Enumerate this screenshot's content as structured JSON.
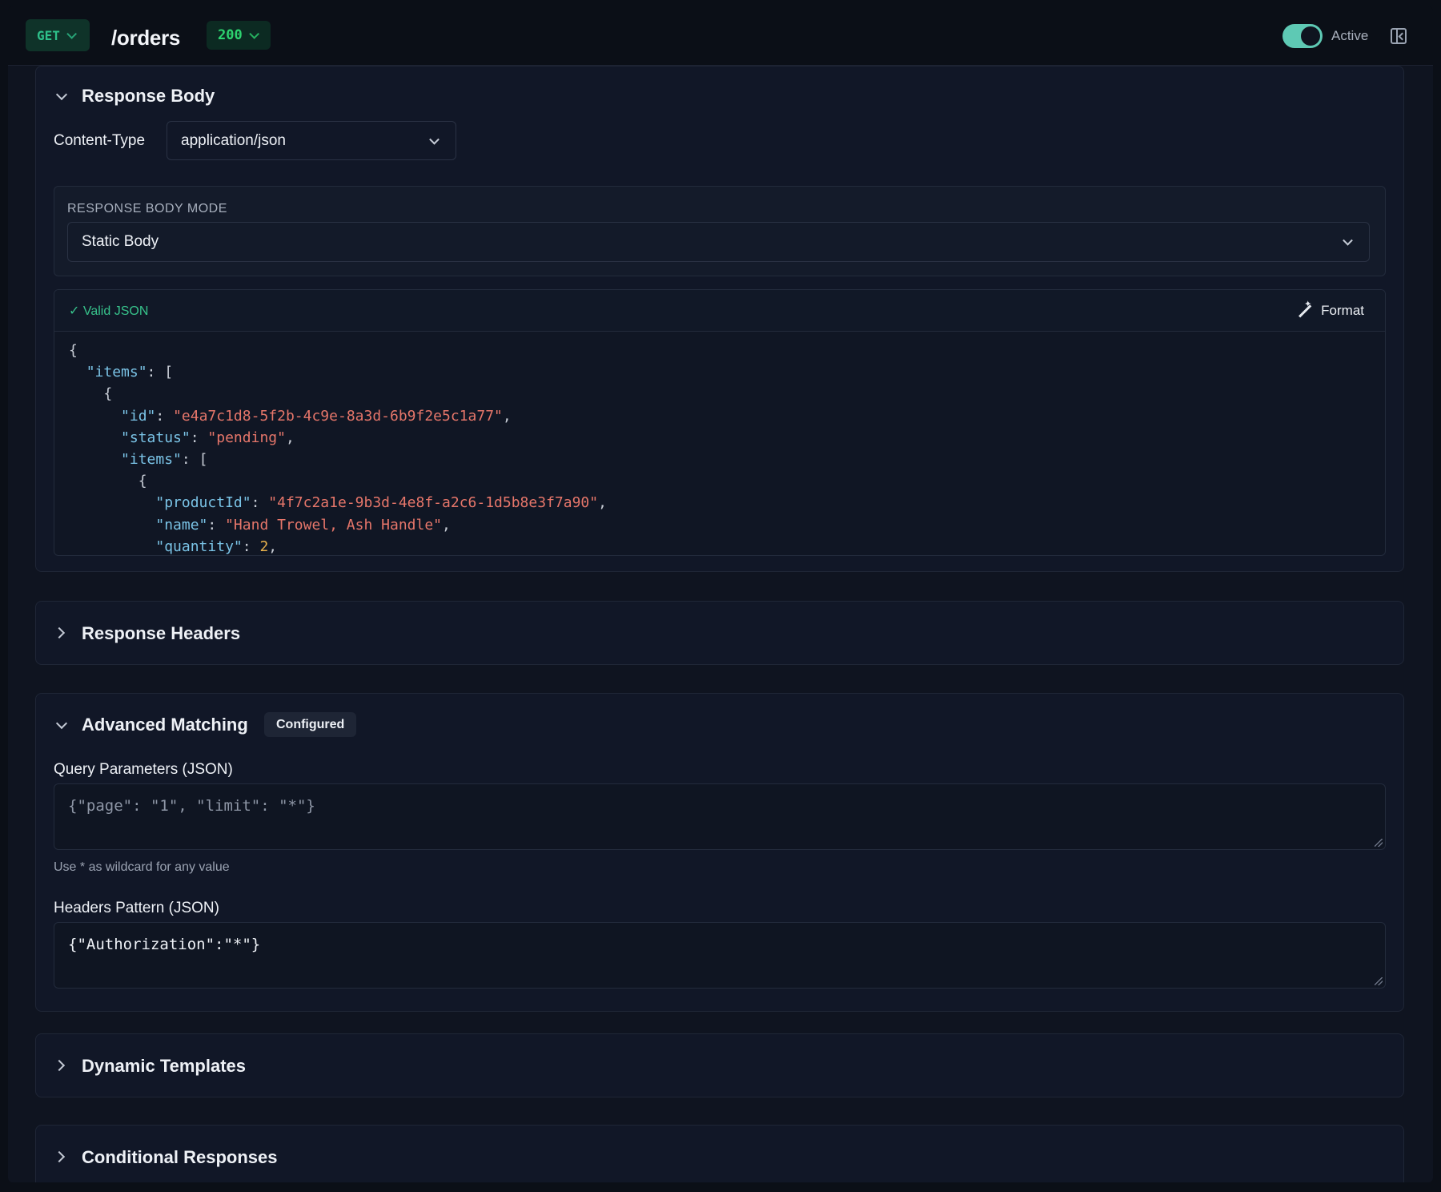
{
  "header": {
    "method": "GET",
    "path": "/orders",
    "status_code": "200",
    "active_label": "Active",
    "active": true
  },
  "response_body": {
    "title": "Response Body",
    "content_type_label": "Content-Type",
    "content_type_value": "application/json",
    "mode_label": "RESPONSE BODY MODE",
    "mode_value": "Static Body",
    "valid_label": "Valid JSON",
    "format_label": "Format",
    "code_lines": [
      "{",
      "  \"items\": [",
      "    {",
      "      \"id\": \"e4a7c1d8-5f2b-4c9e-8a3d-6b9f2e5c1a77\",",
      "      \"status\": \"pending\",",
      "      \"items\": [",
      "        {",
      "          \"productId\": \"4f7c2a1e-9b3d-4e8f-a2c6-1d5b8e3f7a90\",",
      "          \"name\": \"Hand Trowel, Ash Handle\",",
      "          \"quantity\": 2,"
    ]
  },
  "response_headers": {
    "title": "Response Headers"
  },
  "advanced_matching": {
    "title": "Advanced Matching",
    "badge": "Configured",
    "query_label": "Query Parameters (JSON)",
    "query_placeholder": "{\"page\": \"1\", \"limit\": \"*\"}",
    "query_hint": "Use * as wildcard for any value",
    "headers_label": "Headers Pattern (JSON)",
    "headers_value": "{\"Authorization\":\"*\"}"
  },
  "dynamic_templates": {
    "title": "Dynamic Templates"
  },
  "conditional_responses": {
    "title": "Conditional Responses"
  },
  "colors": {
    "accent_teal": "#5ec9b4",
    "method_green": "#2ec08a",
    "json_key": "#7ac3e6",
    "json_string": "#e6766a",
    "json_number": "#e9b24d"
  }
}
